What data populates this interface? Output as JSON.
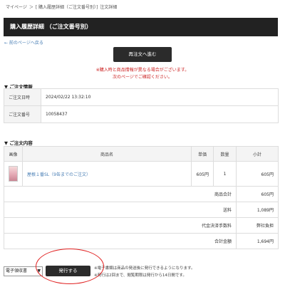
{
  "breadcrumb": {
    "home": "マイページ",
    "sep1": "＞",
    "parent": "[ 購入履歴詳細（ご注文番号別）]",
    "current": "注文詳細"
  },
  "page": {
    "title": "購入履歴詳細 （ご注文番号別）",
    "back_link": "← 前のページへ戻る",
    "reorder_button": "再注文へ進む",
    "notice_line1": "※購入時と商品情報が異なる場合がございます。",
    "notice_line2": "次のページでご確認ください。"
  },
  "order_info": {
    "section_title": "▼ ご注文情報",
    "rows": [
      {
        "label": "ご注文日時",
        "value": "2024/02/22 13:32:10"
      },
      {
        "label": "ご注文番号",
        "value": "10058437"
      }
    ]
  },
  "order_content": {
    "section_title": "▼ ご注文内容",
    "headers": {
      "image": "画像",
      "name": "商品名",
      "unit_price": "単価",
      "qty": "数量",
      "subtotal": "小計"
    },
    "items": [
      {
        "name": "屋根１番SL（9缶までのご注文）",
        "unit_price": "605円",
        "qty": "1",
        "subtotal": "605円"
      }
    ],
    "summary": [
      {
        "label": "商品合計",
        "value": "605円"
      },
      {
        "label": "送料",
        "value": "1,089円"
      },
      {
        "label": "代金決済手数料",
        "value": "弊社負担"
      },
      {
        "label": "合計金額",
        "value": "1,694円"
      }
    ]
  },
  "receipt": {
    "select_value": "電子領収書",
    "issue_button": "発行する",
    "note1": "※電子書類は商品の発送後に発行できるようになります。",
    "note2": "※発行は2回まで、閲覧期限は発行から14日間です。"
  },
  "colors": {
    "title_bg": "#222222",
    "link": "#4a7fb5",
    "notice": "#cc2222",
    "annotation_circle": "#e02020"
  }
}
